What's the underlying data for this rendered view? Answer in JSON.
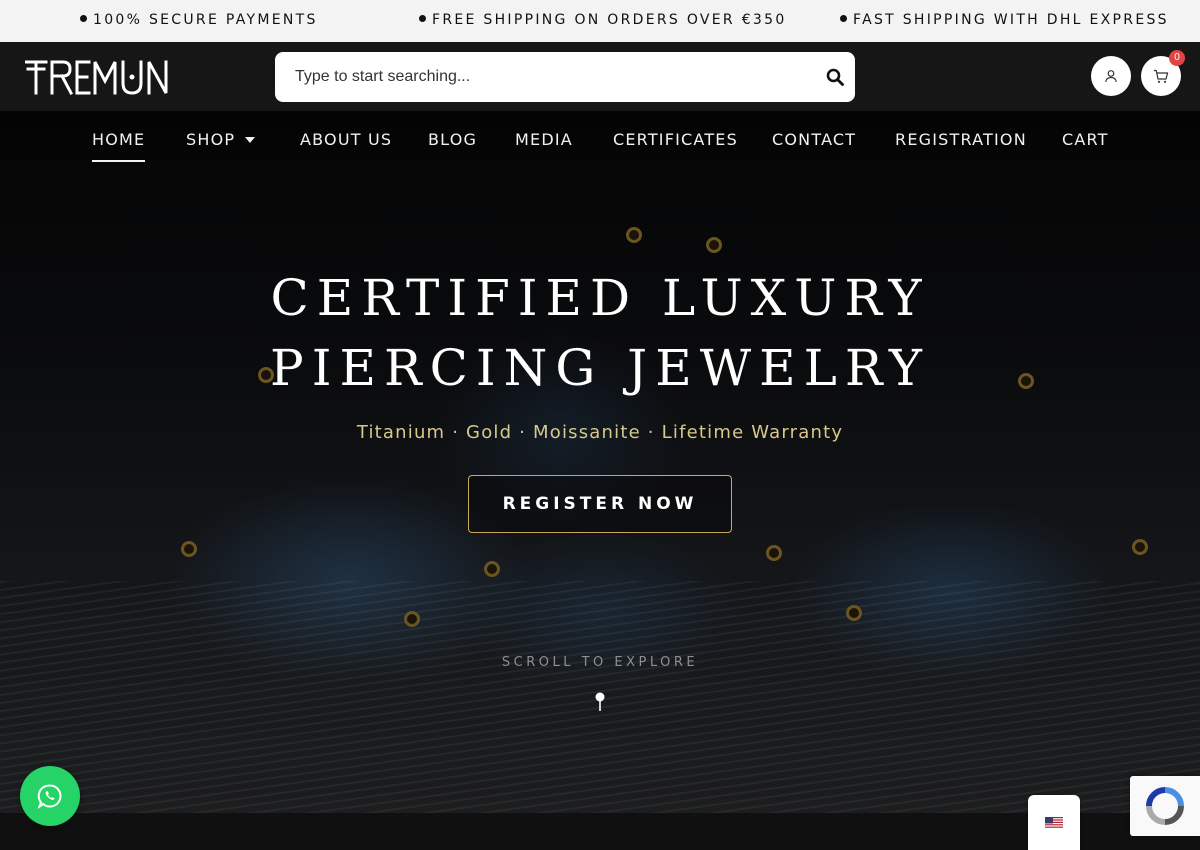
{
  "topbar": {
    "messages": [
      "100% SECURE PAYMENTS",
      "FREE SHIPPING ON ORDERS OVER €350",
      "FAST SHIPPING WITH DHL EXPRESS"
    ]
  },
  "header": {
    "logo_text": "TREMUN",
    "search": {
      "placeholder": "Type to start searching...",
      "value": ""
    },
    "cart_count": "0",
    "icons": {
      "search": "search-icon",
      "account": "user-icon",
      "cart": "cart-icon"
    }
  },
  "nav": {
    "items": [
      {
        "label": "HOME",
        "active": true
      },
      {
        "label": "SHOP",
        "has_dropdown": true
      },
      {
        "label": "ABOUT US"
      },
      {
        "label": "BLOG"
      },
      {
        "label": "MEDIA"
      },
      {
        "label": "CERTIFICATES"
      },
      {
        "label": "CONTACT"
      },
      {
        "label": "REGISTRATION"
      },
      {
        "label": "CART"
      }
    ]
  },
  "hero": {
    "title": "CERTIFIED LUXURY PIERCING JEWELRY",
    "subtitle": "Titanium · Gold · Moissanite · Lifetime Warranty",
    "cta_label": "REGISTER NOW",
    "scroll_text": "SCROLL TO EXPLORE"
  },
  "widgets": {
    "whatsapp_icon": "whatsapp-icon",
    "language_icon": "us-flag-icon",
    "recaptcha_icon": "recaptcha-icon"
  },
  "colors": {
    "accent_gold": "#c9a85a",
    "subtitle_gold": "#d8c88a",
    "whatsapp_green": "#25d366",
    "badge_red": "#e04444",
    "header_bg": "#161616"
  }
}
